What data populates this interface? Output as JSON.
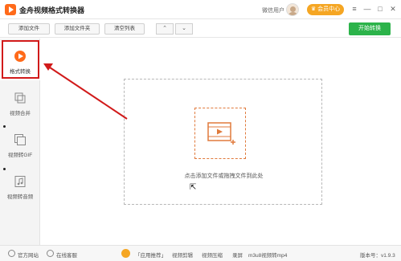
{
  "titlebar": {
    "app_title": "金舟视频格式转换器",
    "user_label": "微信用户",
    "member_button": "会员中心",
    "controls": {
      "menu": "≡",
      "minimize": "—",
      "maximize": "□",
      "close": "✕"
    }
  },
  "toolbar": {
    "add_file": "添加文件",
    "add_folder": "添加文件夹",
    "clear_list": "清空列表",
    "move_up": "⌃",
    "move_down": "⌄",
    "start_convert": "开始转换"
  },
  "sidebar": {
    "items": [
      {
        "label": "格式转换",
        "icon": "play-circle-icon",
        "active": true
      },
      {
        "label": "视频合并",
        "icon": "merge-icon",
        "active": false
      },
      {
        "label": "视频转GIF",
        "icon": "gif-icon",
        "active": false
      },
      {
        "label": "视频转音频",
        "icon": "music-note-icon",
        "active": false
      }
    ]
  },
  "main": {
    "drop_hint": "点击添加文件或拖拽文件到此处"
  },
  "statusbar": {
    "website": "官方网站",
    "support": "在线客服",
    "promo_links": [
      "「应用推荐」",
      "视频剪辑",
      "视频压缩",
      "录屏",
      "m3u8视频转mp4"
    ],
    "version": "版本号：v1.9.3"
  },
  "colors": {
    "accent_orange": "#ff6a1a",
    "start_green": "#2cb34a",
    "highlight_red": "#d11a1a",
    "member_gold": "#f5a623"
  }
}
